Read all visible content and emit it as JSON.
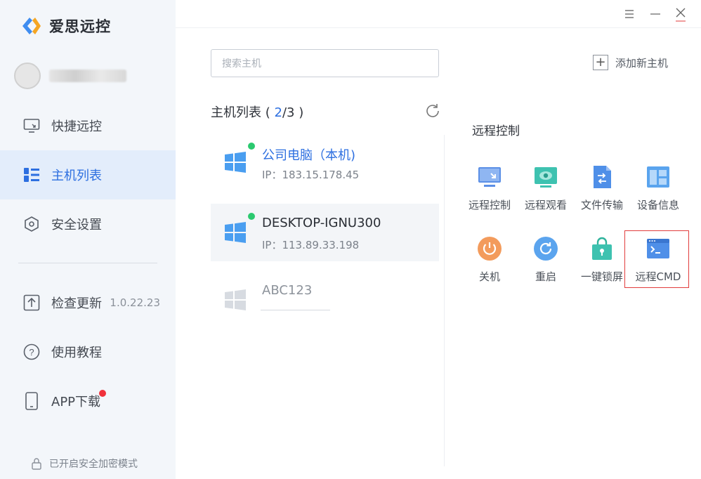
{
  "app": {
    "name": "爱思远控"
  },
  "window_controls": {
    "menu": "☰",
    "minimize": "—",
    "close": "✕"
  },
  "sidebar": {
    "nav": [
      {
        "label": "快捷远控"
      },
      {
        "label": "主机列表"
      },
      {
        "label": "安全设置"
      },
      {
        "label": "检查更新",
        "version": "1.0.22.23"
      },
      {
        "label": "使用教程"
      },
      {
        "label": "APP下载"
      }
    ],
    "security_note": "已开启安全加密模式"
  },
  "search": {
    "placeholder": "搜索主机",
    "value": ""
  },
  "add_host": {
    "label": "添加新主机"
  },
  "host_list": {
    "title": "主机列表",
    "open": "( ",
    "online": "2",
    "sep": "/",
    "total": "3",
    "close": " )",
    "hosts": [
      {
        "name": "公司电脑（本机)",
        "ip": "IP：183.15.178.45",
        "status": "online"
      },
      {
        "name": "DESKTOP-IGNU300",
        "ip": "IP：113.89.33.198",
        "status": "online"
      },
      {
        "name": "ABC123",
        "ip": "",
        "status": "offline"
      }
    ]
  },
  "remote_panel": {
    "title": "远程控制",
    "actions": [
      {
        "label": "远程控制",
        "icon": "remote-control-icon"
      },
      {
        "label": "远程观看",
        "icon": "remote-view-icon"
      },
      {
        "label": "文件传输",
        "icon": "file-transfer-icon"
      },
      {
        "label": "设备信息",
        "icon": "device-info-icon"
      },
      {
        "label": "关机",
        "icon": "shutdown-icon"
      },
      {
        "label": "重启",
        "icon": "restart-icon"
      },
      {
        "label": "一键锁屏",
        "icon": "lock-screen-icon"
      },
      {
        "label": "远程CMD",
        "icon": "remote-cmd-icon"
      }
    ]
  },
  "colors": {
    "accent": "#2d6fe0",
    "online": "#2bc96f",
    "highlight": "#e13d3d",
    "badge": "#f0313b"
  }
}
